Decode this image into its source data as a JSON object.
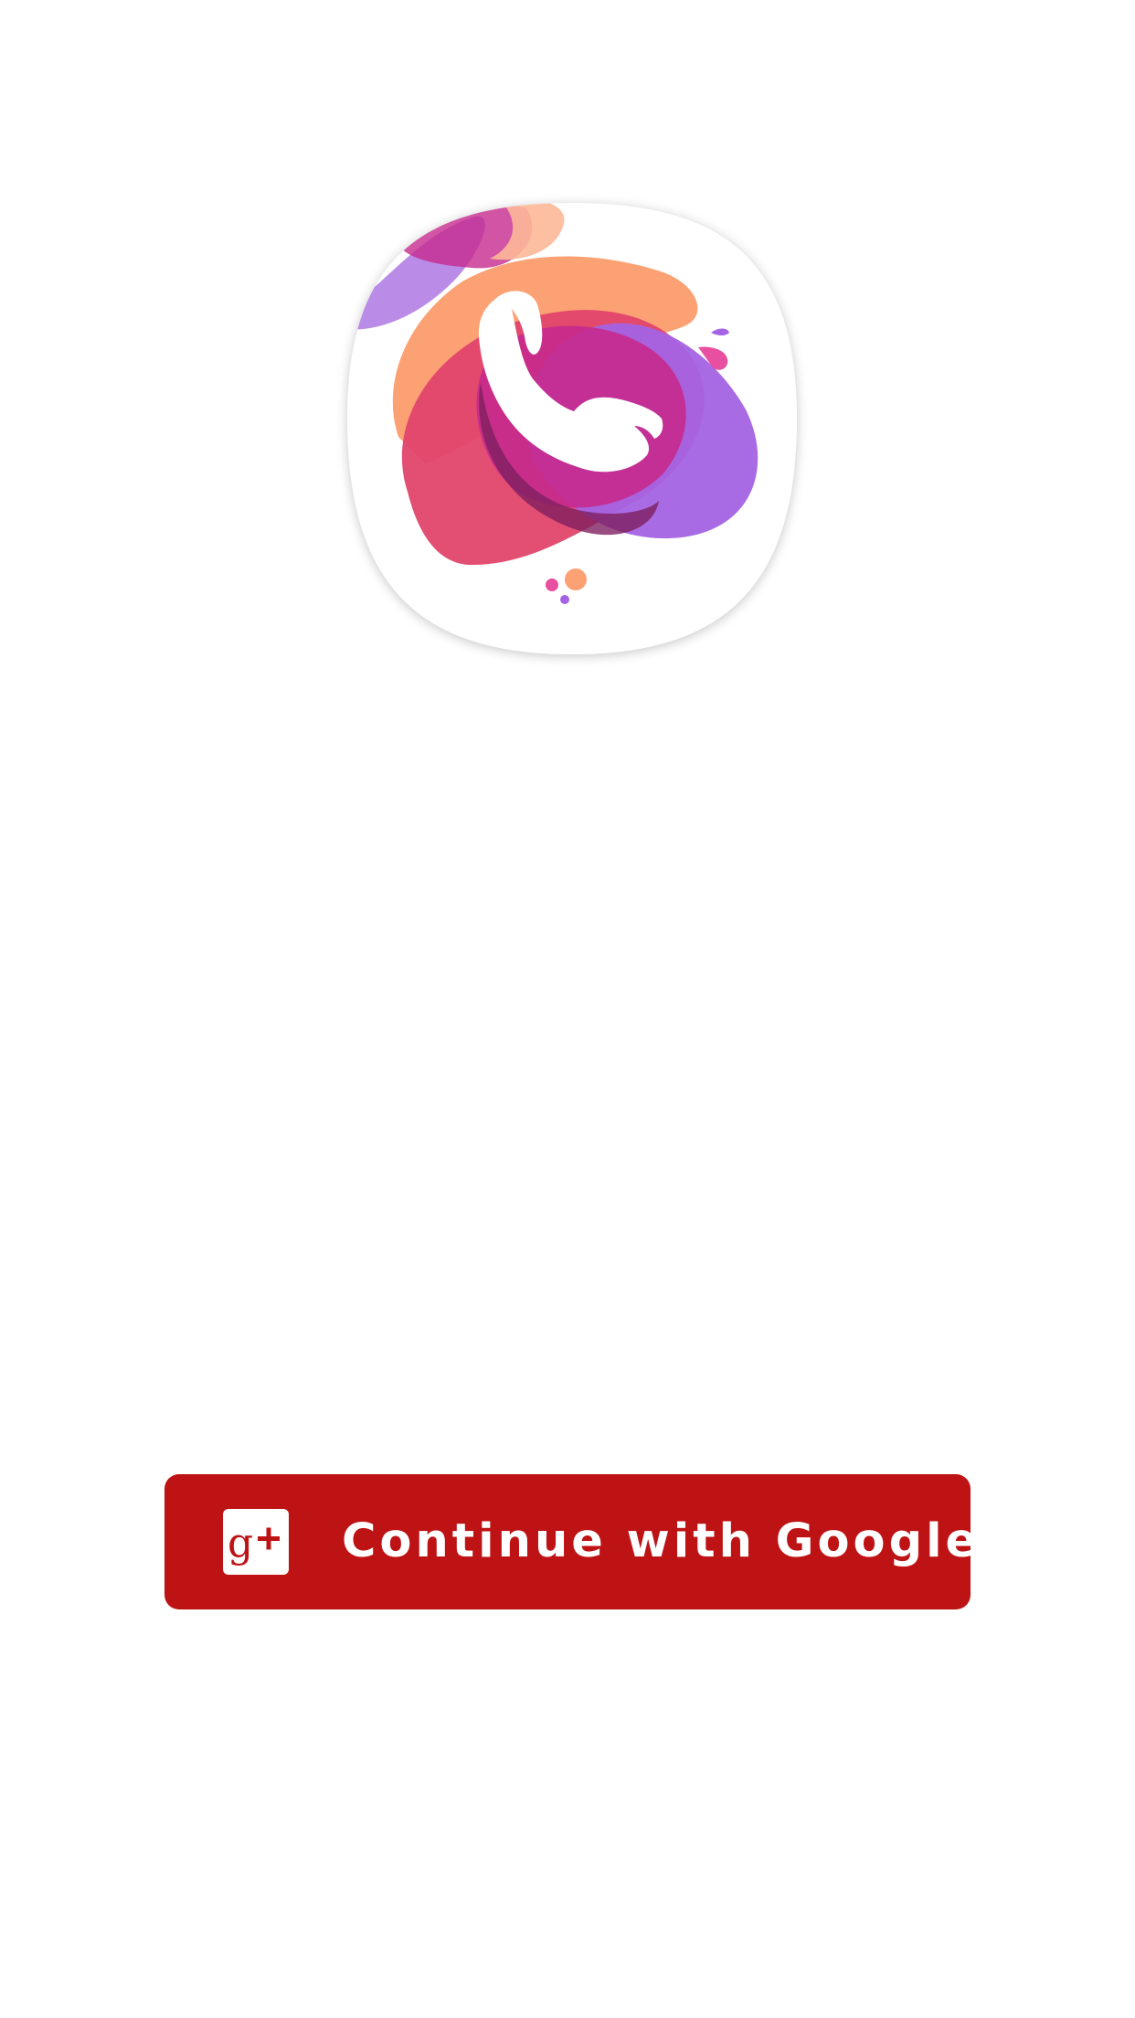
{
  "app_icon": {
    "icon": "phone-handset-icon",
    "colors": {
      "orange": "#fca173",
      "magenta": "#c52a8d",
      "pink_red": "#e2456b",
      "purple": "#a463e3",
      "lavender": "#b27fe6",
      "dark_shadow": "#7e1f5f",
      "white": "#ffffff"
    }
  },
  "login": {
    "google_button": {
      "label": "Continue with Google",
      "icon": "google-plus-icon",
      "background": "#be1315",
      "text_color": "#ffffff"
    }
  }
}
